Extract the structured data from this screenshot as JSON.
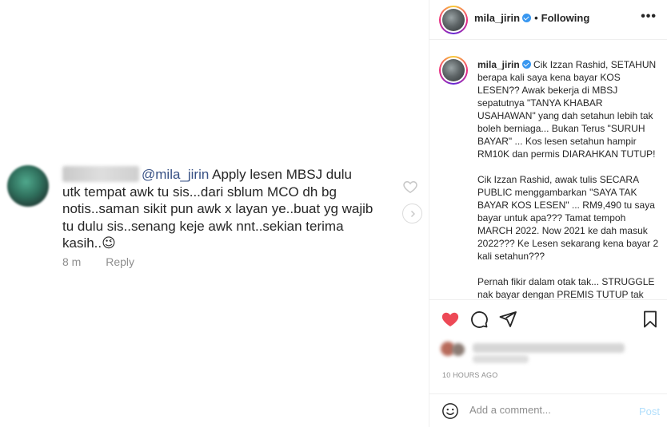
{
  "comment": {
    "mention": "@mila_jirin",
    "line1": "Apply lesen MBSJ dulu",
    "line2": "utk tempat awk tu sis...dari sblum MCO dh bg",
    "line3": "notis..saman sikit pun awk x layan ye..buat yg wajib",
    "line4": "tu dulu sis..senang keje awk nnt..sekian terima",
    "line5": "kasih..",
    "emoji": "😉",
    "time": "8 m",
    "reply": "Reply"
  },
  "header": {
    "username": "mila_jirin",
    "dot": "•",
    "follow": "Following",
    "more": "•••"
  },
  "caption": {
    "username": "mila_jirin",
    "text": " Cik Izzan Rashid, SETAHUN berapa kali saya kena bayar KOS LESEN?? Awak bekerja di MBSJ sepatutnya \"TANYA KHABAR USAHAWAN\" yang dah setahun lebih tak boleh berniaga... Bukan Terus \"SURUH BAYAR\" ... Kos lesen setahun hampir RM10K dan permis DIARAHKAN TUTUP!\n\nCik Izzan Rashid, awak tulis SECARA PUBLIC menggambarkan \"SAYA TAK BAYAR KOS LESEN\" ... RM9,490 tu saya bayar untuk apa??? Tamat tempoh MARCH 2022. Now 2021 ke dah masuk 2022??? Ke Lesen sekarang kena bayar 2 kali setahun???\n\nPernah fikir dalam otak tak... STRUGGLE nak bayar dengan PREMIS TUTUP tak"
  },
  "footer": {
    "time": "10 HOURS AGO",
    "add_placeholder": "Add a comment...",
    "post": "Post"
  },
  "colors": {
    "like_red": "#ed4956",
    "link_blue": "#385185",
    "verified_blue": "#3897f0",
    "post_disabled": "#b2dffc"
  },
  "icons": [
    "heart-icon",
    "chevron-right-icon",
    "more-icon",
    "comment-icon",
    "share-icon",
    "bookmark-icon",
    "emoji-icon",
    "verified-icon"
  ]
}
